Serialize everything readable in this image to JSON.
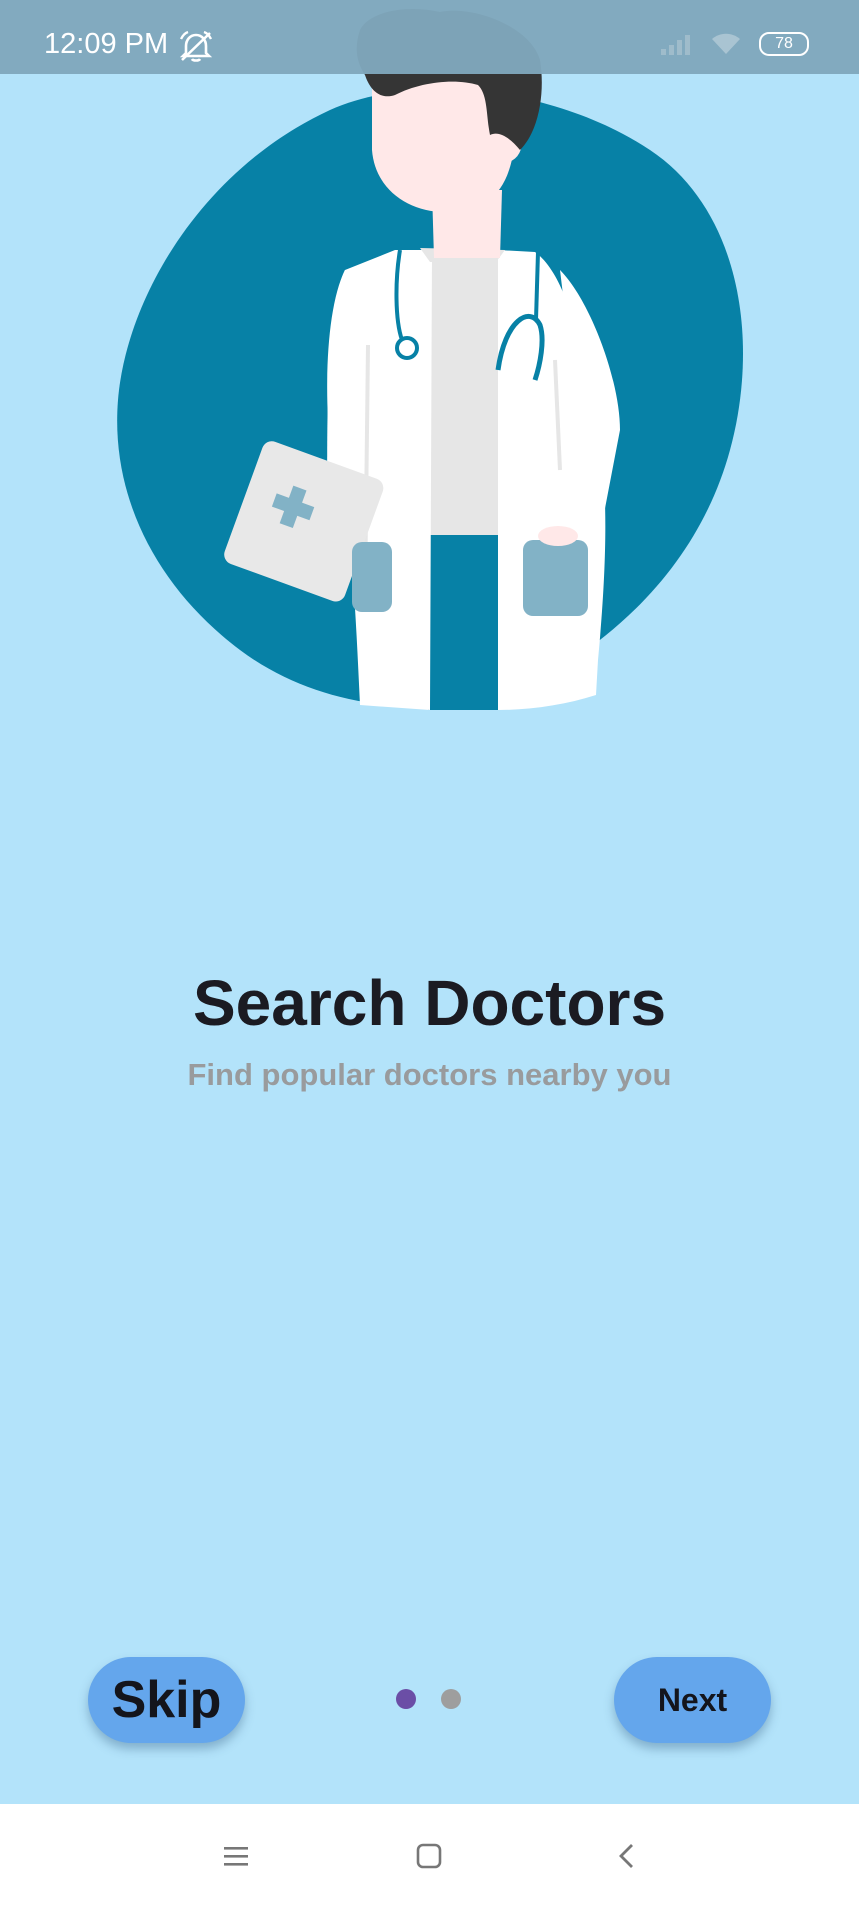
{
  "status_bar": {
    "time": "12:09 PM",
    "battery": "78",
    "icons": [
      "mute-alarm-icon",
      "signal-icon",
      "wifi-icon",
      "battery-icon"
    ]
  },
  "onboarding": {
    "title": "Search Doctors",
    "subtitle": "Find popular doctors nearby you",
    "illustration": "doctor-illustration",
    "page_indicator": {
      "total": 2,
      "current": 1,
      "active_color": "#6b4ea6",
      "inactive_color": "#9e9e9e"
    }
  },
  "buttons": {
    "skip_label": "Skip",
    "next_label": "Next"
  },
  "nav_bar": {
    "icons": [
      "menu-icon",
      "home-icon",
      "back-icon"
    ]
  },
  "colors": {
    "background": "#b3e3fa",
    "status_bar": "#80a8bc",
    "button": "#64a6ec",
    "blob": "#0781a6",
    "title": "#1b1b22",
    "subtitle": "#999b9d"
  }
}
